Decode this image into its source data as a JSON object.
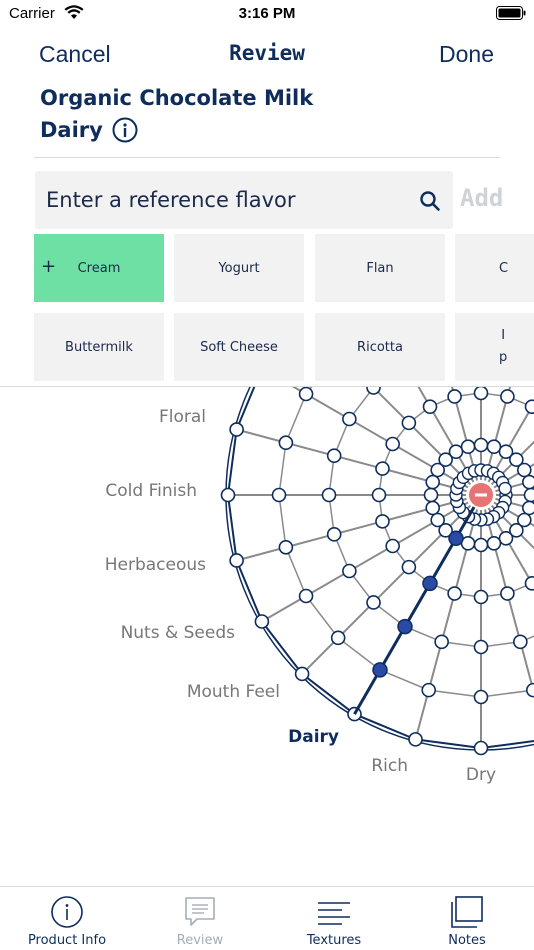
{
  "status": {
    "carrier": "Carrier",
    "time": "3:16 PM"
  },
  "nav": {
    "cancel": "Cancel",
    "title": "Review",
    "done": "Done"
  },
  "product": {
    "name": "Organic Chocolate Milk",
    "category": "Dairy"
  },
  "search": {
    "placeholder": "Enter a reference flavor",
    "add_label": "Add"
  },
  "chips": {
    "row1": [
      "Cream",
      "Yogurt",
      "Flan",
      "C"
    ],
    "row2": [
      "Buttermilk",
      "Soft Cheese",
      "Ricotta",
      "I\np"
    ],
    "selected": "Cream"
  },
  "wheel": {
    "labels": [
      "Floral",
      "Cold Finish",
      "Herbaceous",
      "Nuts & Seeds",
      "Mouth Feel",
      "Dairy",
      "Rich",
      "Dry"
    ],
    "active": "Dairy",
    "rings": 5,
    "dairy_level": 4
  },
  "tabs": [
    {
      "label": "Product Info",
      "icon": "info-icon",
      "active": true
    },
    {
      "label": "Review",
      "icon": "message-icon",
      "active": false
    },
    {
      "label": "Textures",
      "icon": "lines-icon",
      "active": true
    },
    {
      "label": "Notes",
      "icon": "notes-icon",
      "active": true
    }
  ],
  "colors": {
    "navy": "#0f2d5c",
    "selected": "#6ee0a3",
    "center": "#e77474",
    "highlight": "#2b4aa8"
  }
}
